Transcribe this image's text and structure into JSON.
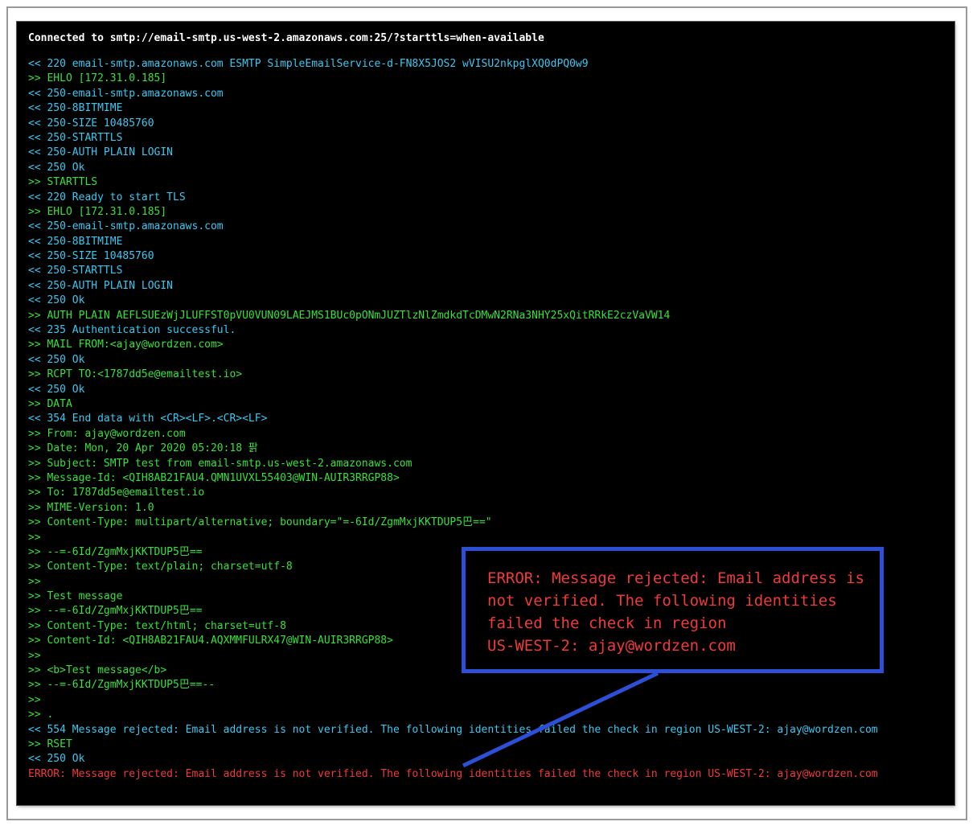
{
  "terminal": {
    "header": "Connected to smtp://email-smtp.us-west-2.amazonaws.com:25/?starttls=when-available",
    "lines": [
      {
        "kind": "in",
        "text": "<< 220 email-smtp.amazonaws.com ESMTP SimpleEmailService-d-FN8X5JOS2 wVISU2nkpglXQ0dPQ0w9"
      },
      {
        "kind": "out",
        "text": ">> EHLO [172.31.0.185]"
      },
      {
        "kind": "in",
        "text": "<< 250-email-smtp.amazonaws.com"
      },
      {
        "kind": "in",
        "text": "<< 250-8BITMIME"
      },
      {
        "kind": "in",
        "text": "<< 250-SIZE 10485760"
      },
      {
        "kind": "in",
        "text": "<< 250-STARTTLS"
      },
      {
        "kind": "in",
        "text": "<< 250-AUTH PLAIN LOGIN"
      },
      {
        "kind": "in",
        "text": "<< 250 Ok"
      },
      {
        "kind": "out",
        "text": ">> STARTTLS"
      },
      {
        "kind": "in",
        "text": "<< 220 Ready to start TLS"
      },
      {
        "kind": "out",
        "text": ">> EHLO [172.31.0.185]"
      },
      {
        "kind": "in",
        "text": "<< 250-email-smtp.amazonaws.com"
      },
      {
        "kind": "in",
        "text": "<< 250-8BITMIME"
      },
      {
        "kind": "in",
        "text": "<< 250-SIZE 10485760"
      },
      {
        "kind": "in",
        "text": "<< 250-STARTTLS"
      },
      {
        "kind": "in",
        "text": "<< 250-AUTH PLAIN LOGIN"
      },
      {
        "kind": "in",
        "text": "<< 250 Ok"
      },
      {
        "kind": "out",
        "text": ">> AUTH PLAIN AEFLSUEzWjJLUFFST0pVU0VUN09LAEJMS1BUc0pONmJUZTlzNlZmdkdTcDMwN2RNa3NHY25xQitRRkE2czVaVW14"
      },
      {
        "kind": "in",
        "text": "<< 235 Authentication successful."
      },
      {
        "kind": "out",
        "text": ">> MAIL FROM:<ajay@wordzen.com>"
      },
      {
        "kind": "in",
        "text": "<< 250 Ok"
      },
      {
        "kind": "out",
        "text": ">> RCPT TO:<1787dd5e@emailtest.io>"
      },
      {
        "kind": "in",
        "text": "<< 250 Ok"
      },
      {
        "kind": "out",
        "text": ">> DATA"
      },
      {
        "kind": "in",
        "text": "<< 354 End data with <CR><LF>.<CR><LF>"
      },
      {
        "kind": "out",
        "text": ">> From: ajay@wordzen.com"
      },
      {
        "kind": "out",
        "text": ">> Date: Mon, 20 Apr 2020 05:20:18 팕"
      },
      {
        "kind": "out",
        "text": ">> Subject: SMTP test from email-smtp.us-west-2.amazonaws.com"
      },
      {
        "kind": "out",
        "text": ">> Message-Id: <QIH8AB21FAU4.QMN1UVXL55403@WIN-AUIR3RRGP88>"
      },
      {
        "kind": "out",
        "text": ">> To: 1787dd5e@emailtest.io"
      },
      {
        "kind": "out",
        "text": ">> MIME-Version: 1.0"
      },
      {
        "kind": "out",
        "text": ">> Content-Type: multipart/alternative; boundary=\"=-6Id/ZgmMxjKKTDUP5巴==\""
      },
      {
        "kind": "out",
        "text": ">>"
      },
      {
        "kind": "out",
        "text": ">> --=-6Id/ZgmMxjKKTDUP5巴=="
      },
      {
        "kind": "out",
        "text": ">> Content-Type: text/plain; charset=utf-8"
      },
      {
        "kind": "out",
        "text": ">>"
      },
      {
        "kind": "out",
        "text": ">> Test message"
      },
      {
        "kind": "out",
        "text": ">> --=-6Id/ZgmMxjKKTDUP5巴=="
      },
      {
        "kind": "out",
        "text": ">> Content-Type: text/html; charset=utf-8"
      },
      {
        "kind": "out",
        "text": ">> Content-Id: <QIH8AB21FAU4.AQXMMFULRX47@WIN-AUIR3RRGP88>"
      },
      {
        "kind": "out",
        "text": ">>"
      },
      {
        "kind": "out",
        "text": ">> <b>Test message</b>"
      },
      {
        "kind": "out",
        "text": ">> --=-6Id/ZgmMxjKKTDUP5巴==--"
      },
      {
        "kind": "out",
        "text": ">>"
      },
      {
        "kind": "out",
        "text": ">> ."
      },
      {
        "kind": "in",
        "text": "<< 554 Message rejected: Email address is not verified. The following identities failed the check in region US-WEST-2: ajay@wordzen.com"
      },
      {
        "kind": "out",
        "text": ">> RSET"
      },
      {
        "kind": "in",
        "text": "<< 250 Ok"
      },
      {
        "kind": "err",
        "text": "ERROR: Message rejected: Email address is not verified. The following identities failed the check in region US-WEST-2: ajay@wordzen.com"
      }
    ]
  },
  "callout": {
    "lines": [
      "ERROR: Message rejected: Email address is",
      "not verified. The following identities",
      "failed the check in region",
      "US-WEST-2: ajay@wordzen.com"
    ]
  },
  "colors": {
    "server_response": "#3ac8f0",
    "client_command": "#37e03a",
    "error": "#f03a3a",
    "callout_border": "#2d4fd8"
  }
}
